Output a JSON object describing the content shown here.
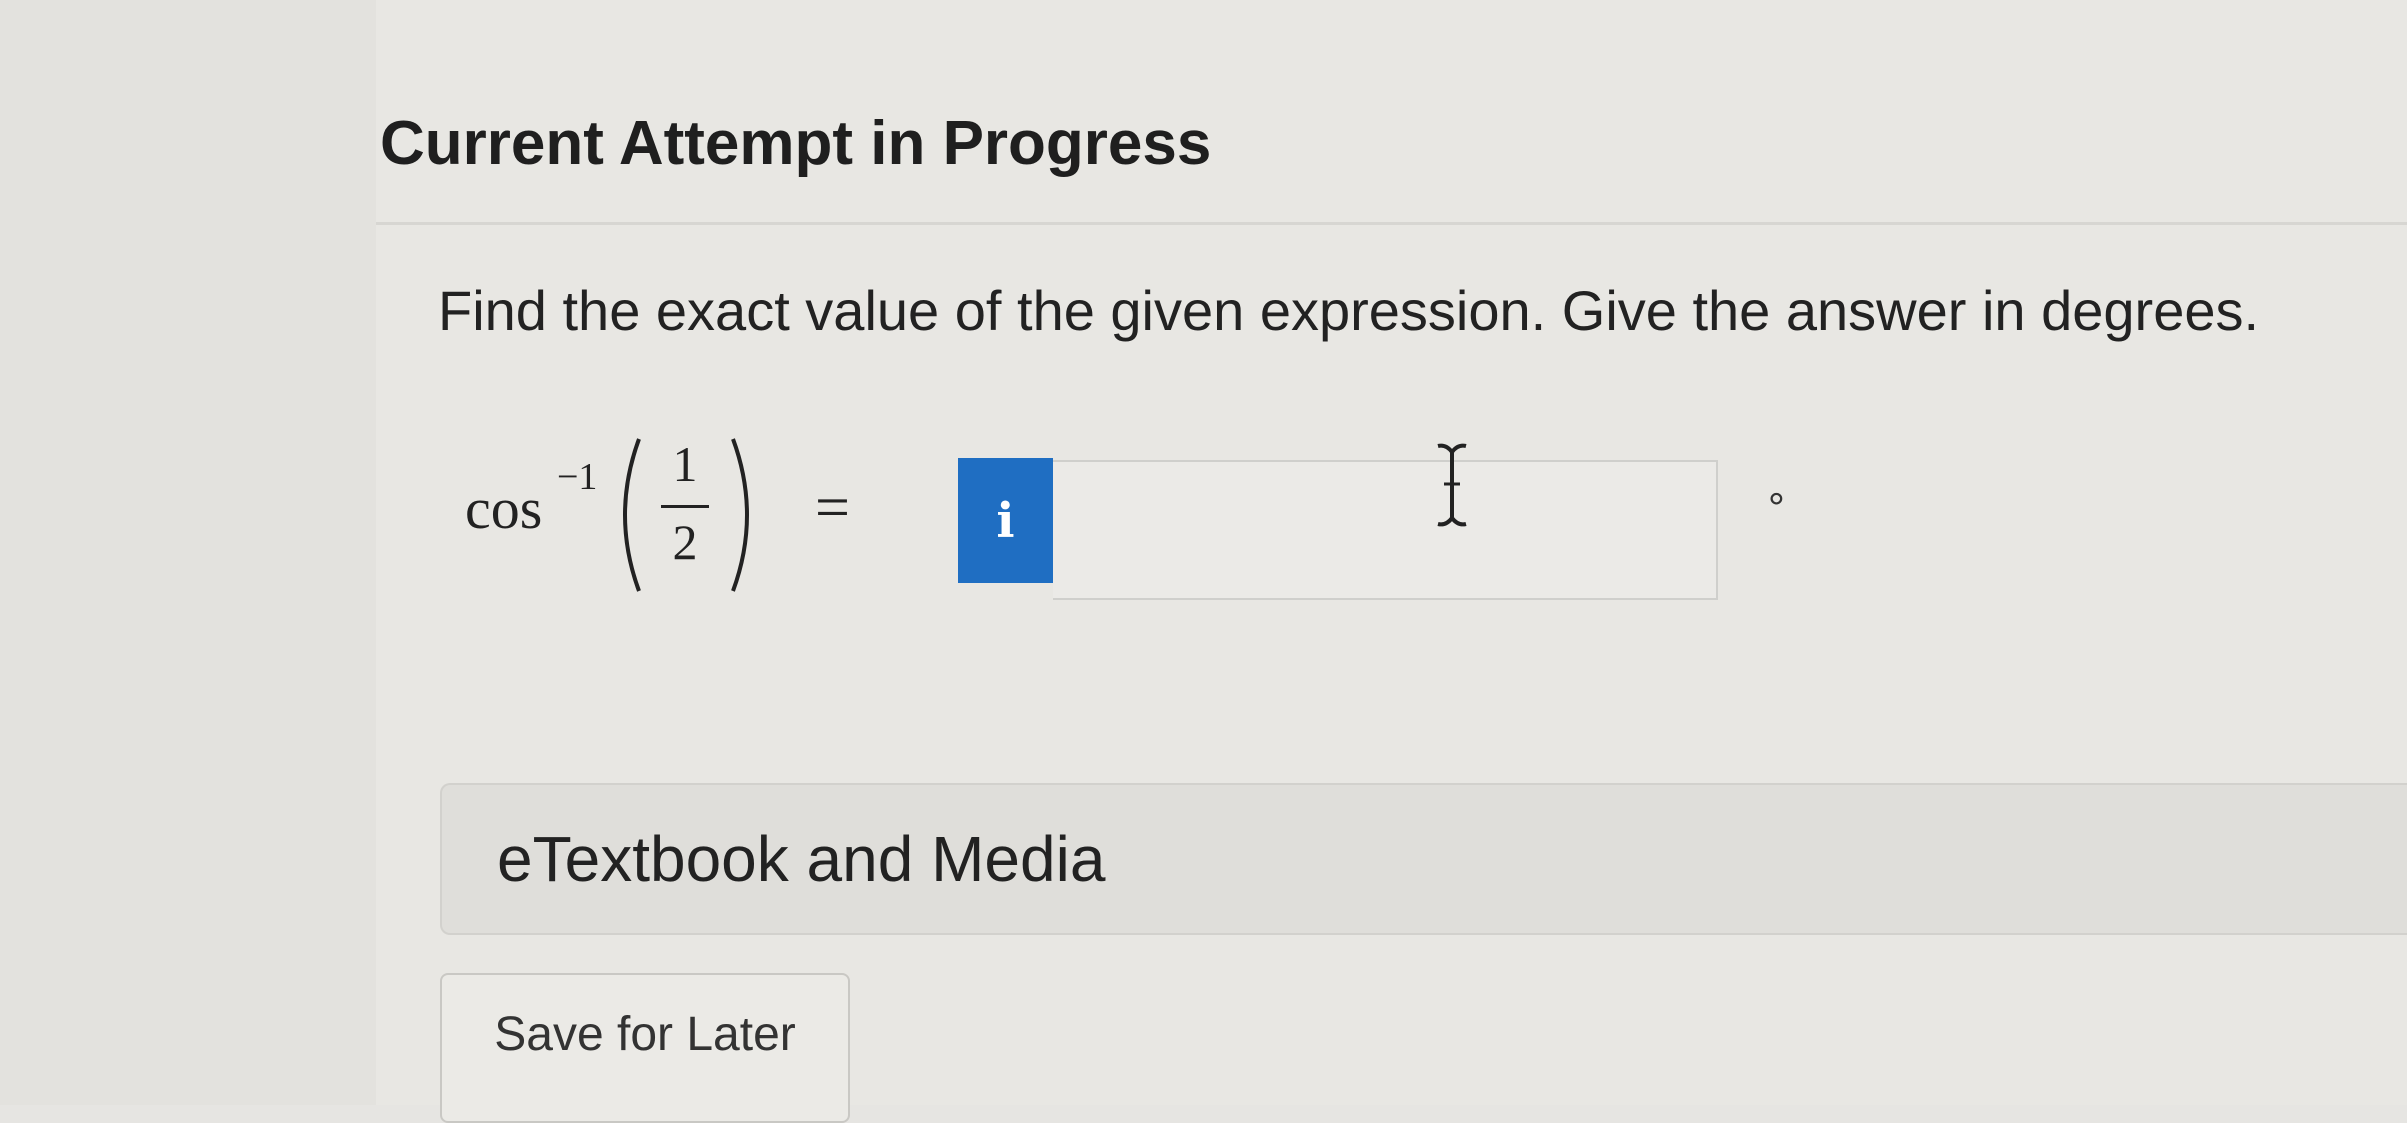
{
  "header": {
    "title": "Current Attempt in Progress"
  },
  "question": {
    "prompt": "Find the exact value of the given expression. Give the answer in degrees.",
    "expression": {
      "function": "cos",
      "exponent": "−1",
      "numerator": "1",
      "denominator": "2",
      "equals": "="
    },
    "info_badge": "i",
    "answer": {
      "value": "",
      "placeholder": ""
    },
    "unit": "°"
  },
  "resources": {
    "label": "eTextbook and Media"
  },
  "actions": {
    "save_label": "Save for Later"
  },
  "colors": {
    "info_badge": "#1f6ec2",
    "background": "#e8e7e3"
  },
  "icons": {
    "info": "info-icon",
    "cursor": "text-cursor-icon"
  }
}
